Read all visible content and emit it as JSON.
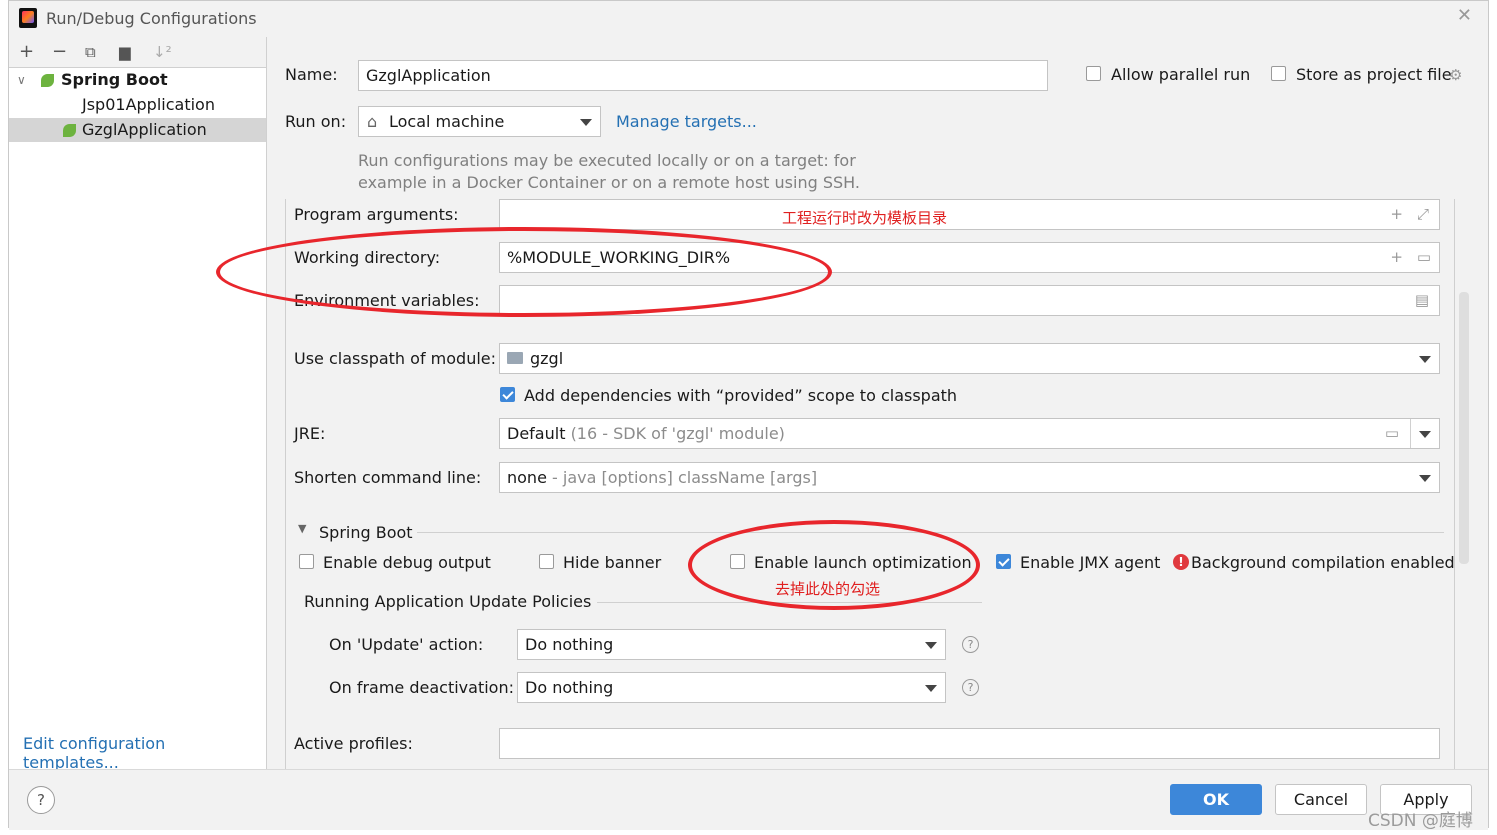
{
  "window": {
    "title": "Run/Debug Configurations"
  },
  "toolbar": {
    "add": "+",
    "remove": "−",
    "copy_icon": "copy-icon",
    "folder_icon": "folder-icon",
    "sort_icon": "sort-icon"
  },
  "tree": {
    "group_label": "Spring Boot",
    "items": [
      {
        "label": "Jsp01Application"
      },
      {
        "label": "GzglApplication"
      }
    ]
  },
  "edit_templates": "Edit configuration templates...",
  "name": {
    "label": "Name:",
    "value": "GzglApplication"
  },
  "allow_parallel": {
    "label": "Allow parallel run",
    "checked": false
  },
  "store_project": {
    "label": "Store as project file",
    "checked": false
  },
  "run_on": {
    "label": "Run on:",
    "value": "Local machine",
    "manage": "Manage targets..."
  },
  "run_on_hint": [
    "Run configurations may be executed locally or on a target: for",
    "example in a Docker Container or on a remote host using SSH."
  ],
  "program_args": {
    "label": "Program arguments:"
  },
  "working_dir": {
    "label": "Working directory:",
    "value": "%MODULE_WORKING_DIR%"
  },
  "env_vars": {
    "label": "Environment variables:"
  },
  "classpath": {
    "label": "Use classpath of module:",
    "value": "gzgl"
  },
  "add_deps": {
    "label": "Add dependencies with “provided” scope to classpath",
    "checked": true
  },
  "jre": {
    "label": "JRE:",
    "value": "Default",
    "detail": "(16 - SDK of 'gzgl' module)"
  },
  "shorten": {
    "label": "Shorten command line:",
    "value": "none",
    "detail": "- java [options] className [args]"
  },
  "spring_boot": {
    "section": "Spring Boot",
    "debug_output": {
      "label": "Enable debug output",
      "checked": false
    },
    "hide_banner": {
      "label": "Hide banner",
      "checked": false
    },
    "launch_opt": {
      "label": "Enable launch optimization",
      "checked": false
    },
    "jmx": {
      "label": "Enable JMX agent",
      "checked": true
    },
    "bg_compile": "Background compilation enabled"
  },
  "policies": {
    "title": "Running Application Update Policies",
    "update": {
      "label": "On 'Update' action:",
      "value": "Do nothing"
    },
    "frame": {
      "label": "On frame deactivation:",
      "value": "Do nothing"
    }
  },
  "active_profiles": {
    "label": "Active profiles:"
  },
  "annotations": {
    "working_dir_note": "工程运行时改为模板目录",
    "launch_opt_note": "去掉此处的勾选"
  },
  "buttons": {
    "ok": "OK",
    "cancel": "Cancel",
    "apply": "Apply",
    "help": "?"
  },
  "watermark": "CSDN @庭博",
  "colors": {
    "accent": "#3d87d9",
    "link": "#2470b3",
    "annotation": "#e8262c"
  }
}
